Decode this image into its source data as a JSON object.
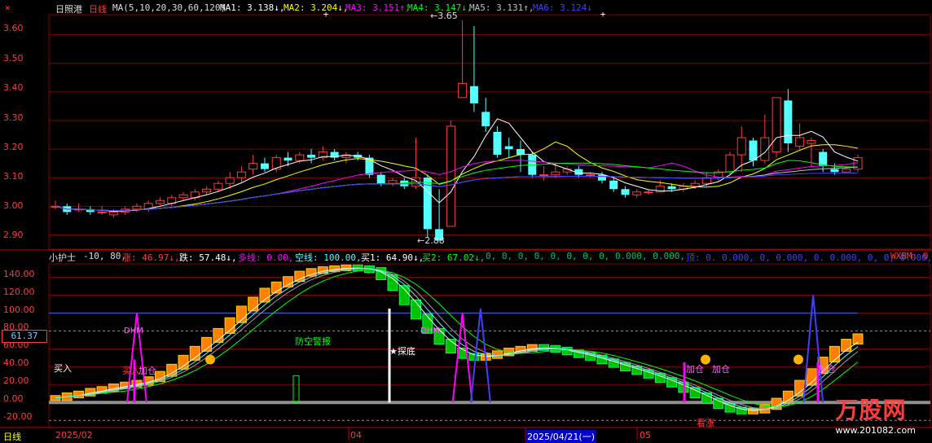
{
  "header": {
    "close_glyph": "×",
    "stock": "日照港",
    "period": "日线",
    "ma_def": "MA(5,10,20,30,60,120)",
    "ma1": "MA1: 3.138↓,",
    "ma2": "MA2: 3.204↓,",
    "ma3": "MA3: 3.151↑,",
    "ma4": "MA4: 3.147↓,",
    "ma5": "MA5: 3.131↑,",
    "ma6": "MA6: 3.124↓"
  },
  "indicator": {
    "name": "小护士",
    "params": "-10, 80,",
    "rise": "涨: 46.97↓,",
    "fall": "跌: 57.48↓,",
    "long_line": "多线: 0.00,",
    "short_line": "空线: 100.00,",
    "buy1": "买1: 64.90↓,",
    "buy2": "买2: 67.02↓,",
    "zeros": "0, 0, 0, 0, 0, 0, 0, 0, 0.000, 0.000,",
    "bottom": "顶: 0. 0.000, 0, 0.000, 0. 0.000, 0, 0, 0.000,",
    "wxbm": "WXBM: 0"
  },
  "price_axis": {
    "labels": [
      "3.60",
      "3.50",
      "3.40",
      "3.30",
      "3.20",
      "3.10",
      "3.00",
      "2.90"
    ]
  },
  "ind_axis": {
    "labels": [
      "140.00",
      "120.00",
      "100.00",
      "80.00",
      "60.00",
      "40.00",
      "20.00",
      "0.00",
      "-20.00"
    ],
    "current": "61.37"
  },
  "dates": {
    "period_tab": "日线",
    "d1": "2025/02",
    "d2": "04",
    "d3": "2025/04/21(一)",
    "d4": "05"
  },
  "annotations": {
    "high": "←3.65",
    "low": "←2.88",
    "buy_in": "买入",
    "buy_in2": "买入",
    "add_pos": "加仓",
    "add_pos2": "加仓",
    "add_pos3": "加仓",
    "add_pos4": "加仓",
    "dhm": "DHM",
    "dhm2": "DHM",
    "air_alarm": "防空警报",
    "probe_bottom": "★探底",
    "bullish": "看涨"
  },
  "watermark": {
    "brand": "万股网",
    "url": "www.201082.com"
  },
  "colors": {
    "up": "#ff3b3b",
    "down": "#54ffff",
    "grid": "#800000",
    "bg": "#000000",
    "ma1": "#ffffff",
    "ma2": "#ffff00",
    "ma3": "#ff00ff",
    "ma4": "#00ff00",
    "ma5": "#c0c0c0",
    "ma6": "#4040ff"
  },
  "chart_data": {
    "type": "candlestick",
    "price_ylim": [
      2.85,
      3.67
    ],
    "ind_ylim": [
      -28,
      155
    ],
    "candles": [
      [
        3.0,
        3.0,
        3.02,
        2.99
      ],
      [
        3.0,
        2.98,
        3.01,
        2.97
      ],
      [
        2.99,
        2.99,
        3.01,
        2.98
      ],
      [
        2.99,
        2.98,
        3.0,
        2.97
      ],
      [
        2.98,
        2.98,
        3.0,
        2.97
      ],
      [
        2.97,
        2.98,
        2.99,
        2.96
      ],
      [
        2.98,
        2.99,
        3.0,
        2.97
      ],
      [
        2.99,
        3.0,
        3.01,
        2.98
      ],
      [
        2.99,
        3.01,
        3.02,
        2.98
      ],
      [
        3.01,
        3.02,
        3.03,
        3.0
      ],
      [
        3.01,
        3.03,
        3.04,
        3.0
      ],
      [
        3.03,
        3.04,
        3.05,
        3.02
      ],
      [
        3.03,
        3.05,
        3.06,
        3.02
      ],
      [
        3.05,
        3.06,
        3.07,
        3.04
      ],
      [
        3.06,
        3.08,
        3.09,
        3.05
      ],
      [
        3.08,
        3.1,
        3.12,
        3.06
      ],
      [
        3.1,
        3.12,
        3.14,
        3.08
      ],
      [
        3.13,
        3.15,
        3.18,
        3.11
      ],
      [
        3.15,
        3.13,
        3.17,
        3.12
      ],
      [
        3.13,
        3.17,
        3.18,
        3.12
      ],
      [
        3.17,
        3.16,
        3.19,
        3.14
      ],
      [
        3.16,
        3.18,
        3.19,
        3.15
      ],
      [
        3.18,
        3.17,
        3.2,
        3.15
      ],
      [
        3.17,
        3.19,
        3.21,
        3.16
      ],
      [
        3.19,
        3.17,
        3.2,
        3.16
      ],
      [
        3.17,
        3.18,
        3.19,
        3.15
      ],
      [
        3.18,
        3.17,
        3.19,
        3.16
      ],
      [
        3.17,
        3.11,
        3.18,
        3.1
      ],
      [
        3.11,
        3.08,
        3.12,
        3.07
      ],
      [
        3.08,
        3.09,
        3.1,
        3.07
      ],
      [
        3.09,
        3.07,
        3.1,
        3.06
      ],
      [
        3.07,
        3.1,
        3.24,
        3.06
      ],
      [
        3.1,
        2.92,
        3.11,
        2.89
      ],
      [
        2.92,
        2.88,
        3.06,
        2.88
      ],
      [
        2.93,
        3.28,
        3.3,
        2.93
      ],
      [
        3.38,
        3.43,
        3.65,
        3.38
      ],
      [
        3.42,
        3.36,
        3.63,
        3.33
      ],
      [
        3.33,
        3.28,
        3.38,
        3.26
      ],
      [
        3.26,
        3.18,
        3.28,
        3.17
      ],
      [
        3.21,
        3.2,
        3.24,
        3.17
      ],
      [
        3.2,
        3.18,
        3.23,
        3.12
      ],
      [
        3.18,
        3.11,
        3.19,
        3.1
      ],
      [
        3.11,
        3.11,
        3.14,
        3.09
      ],
      [
        3.11,
        3.12,
        3.15,
        3.1
      ],
      [
        3.12,
        3.13,
        3.14,
        3.11
      ],
      [
        3.13,
        3.11,
        3.14,
        3.1
      ],
      [
        3.11,
        3.11,
        3.12,
        3.1
      ],
      [
        3.11,
        3.09,
        3.12,
        3.08
      ],
      [
        3.09,
        3.06,
        3.1,
        3.05
      ],
      [
        3.06,
        3.04,
        3.07,
        3.03
      ],
      [
        3.04,
        3.05,
        3.06,
        3.03
      ],
      [
        3.05,
        3.05,
        3.06,
        3.04
      ],
      [
        3.05,
        3.07,
        3.09,
        3.05
      ],
      [
        3.07,
        3.06,
        3.08,
        3.05
      ],
      [
        3.06,
        3.07,
        3.08,
        3.05
      ],
      [
        3.07,
        3.08,
        3.09,
        3.06
      ],
      [
        3.08,
        3.1,
        3.12,
        3.07
      ],
      [
        3.1,
        3.12,
        3.13,
        3.09
      ],
      [
        3.12,
        3.18,
        3.19,
        3.11
      ],
      [
        3.18,
        3.24,
        3.28,
        3.12
      ],
      [
        3.23,
        3.16,
        3.24,
        3.14
      ],
      [
        3.16,
        3.24,
        3.32,
        3.15
      ],
      [
        3.19,
        3.38,
        3.38,
        3.17
      ],
      [
        3.37,
        3.22,
        3.41,
        3.19
      ],
      [
        3.21,
        3.24,
        3.29,
        3.2
      ],
      [
        3.22,
        3.23,
        3.24,
        3.14
      ],
      [
        3.19,
        3.14,
        3.2,
        3.12
      ],
      [
        3.13,
        3.12,
        3.15,
        3.11
      ],
      [
        3.12,
        3.13,
        3.14,
        3.12
      ],
      [
        3.13,
        3.17,
        3.18,
        3.12
      ]
    ],
    "ind_bars": [
      5,
      8,
      10,
      13,
      15,
      18,
      20,
      22,
      26,
      32,
      40,
      50,
      60,
      70,
      80,
      92,
      105,
      115,
      125,
      132,
      138,
      144,
      147,
      149,
      150,
      151,
      150,
      148,
      140,
      128,
      112,
      96,
      80,
      68,
      58,
      52,
      50,
      52,
      55,
      58,
      60,
      62,
      61,
      59,
      56,
      53,
      50,
      46,
      42,
      38,
      34,
      30,
      25,
      20,
      14,
      8,
      2,
      -4,
      -8,
      -10,
      -9,
      -5,
      2,
      10,
      22,
      35,
      48,
      60,
      68,
      74
    ]
  }
}
